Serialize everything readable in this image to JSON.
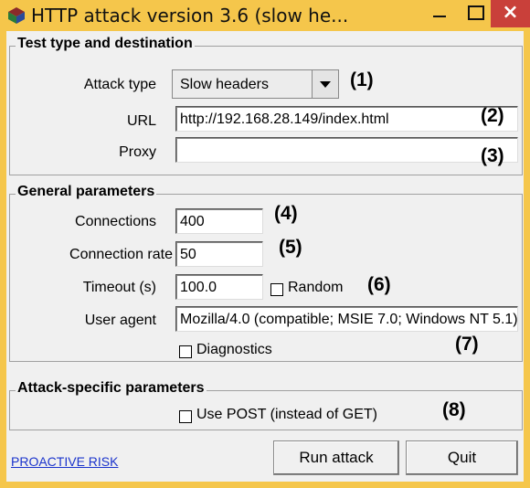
{
  "window": {
    "title": "HTTP attack version 3.6 (slow he...",
    "close_glyph": "×"
  },
  "test_group": {
    "title": "Test type and destination",
    "attack_type_label": "Attack type",
    "attack_type_value": "Slow headers",
    "url_label": "URL",
    "url_value": "http://192.168.28.149/index.html",
    "proxy_label": "Proxy",
    "proxy_value": ""
  },
  "general_group": {
    "title": "General parameters",
    "connections_label": "Connections",
    "connections_value": "400",
    "rate_label": "Connection rate",
    "rate_value": "50",
    "timeout_label": "Timeout (s)",
    "timeout_value": "100.0",
    "random_label": "Random",
    "random_checked": false,
    "user_agent_label": "User agent",
    "user_agent_value": "Mozilla/4.0 (compatible; MSIE 7.0; Windows NT 5.1)",
    "diagnostics_label": "Diagnostics",
    "diagnostics_checked": false
  },
  "attack_group": {
    "title": "Attack-specific parameters",
    "use_post_label": "Use POST (instead of GET)",
    "use_post_checked": false
  },
  "annotations": [
    "(1)",
    "(2)",
    "(3)",
    "(4)",
    "(5)",
    "(6)",
    "(7)",
    "(8)"
  ],
  "footer": {
    "link": "PROACTIVE RISK",
    "run_button": "Run attack",
    "quit_button": "Quit"
  }
}
